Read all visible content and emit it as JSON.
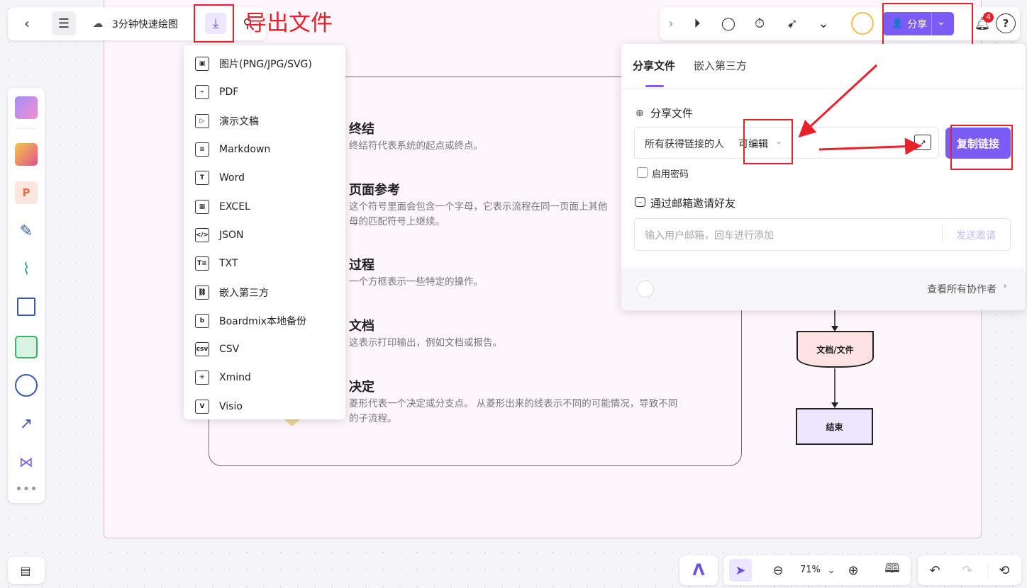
{
  "doc": {
    "title": "3分钟快速绘图"
  },
  "annotation": {
    "export_label": "导出文件"
  },
  "export_menu": {
    "items": [
      {
        "label": "图片(PNG/JPG/SVG)",
        "icon": "image-icon",
        "glyph": "▣"
      },
      {
        "label": "PDF",
        "icon": "pdf-icon",
        "glyph": "⌁"
      },
      {
        "label": "演示文稿",
        "icon": "presentation-icon",
        "glyph": "▷"
      },
      {
        "label": "Markdown",
        "icon": "markdown-icon",
        "glyph": "≡"
      },
      {
        "label": "Word",
        "icon": "word-icon",
        "glyph": "T"
      },
      {
        "label": "EXCEL",
        "icon": "excel-icon",
        "glyph": "▦"
      },
      {
        "label": "JSON",
        "icon": "json-icon",
        "glyph": "</>"
      },
      {
        "label": "TXT",
        "icon": "txt-icon",
        "glyph": "T≡"
      },
      {
        "label": "嵌入第三方",
        "icon": "embed-icon",
        "glyph": "⛓"
      },
      {
        "label": "Boardmix本地备份",
        "icon": "backup-icon",
        "glyph": "b"
      },
      {
        "label": "CSV",
        "icon": "csv-icon",
        "glyph": "csv"
      },
      {
        "label": "Xmind",
        "icon": "xmind-icon",
        "glyph": "✳"
      },
      {
        "label": "Visio",
        "icon": "visio-icon",
        "glyph": "V"
      }
    ]
  },
  "legend": {
    "items": [
      {
        "title": "终结",
        "desc": "终结符代表系统的起点或终点。"
      },
      {
        "title": "页面参考",
        "desc": "这个符号里面会包含一个字母，它表示流程在同一页面上其他\n母的匹配符号上继续。"
      },
      {
        "title": "过程",
        "desc": "一个方框表示一些特定的操作。"
      },
      {
        "title": "文档",
        "desc": "这表示打印输出，例如文档或报告。"
      },
      {
        "title": "决定",
        "desc": "菱形代表一个决定或分支点。 从菱形出来的线表示不同的可能情况，导致不同\n的子流程。"
      }
    ]
  },
  "flowchart": {
    "doc_label": "文档/文件",
    "end_label": "结束"
  },
  "top_right": {
    "share_button": "分享",
    "notification_count": "4"
  },
  "share_panel": {
    "tabs": [
      "分享文件",
      "嵌入第三方"
    ],
    "section_title": "分享文件",
    "link_scope": "所有获得链接的人",
    "permission": "可编辑",
    "copy_button": "复制链接",
    "password_label": "启用密码",
    "invite_title": "通过邮箱邀请好友",
    "email_placeholder": "输入用户邮箱，回车进行添加",
    "send_invite": "发送邀请",
    "view_collaborators": "查看所有协作者"
  },
  "bottom": {
    "zoom": "71%"
  },
  "colors": {
    "accent": "#7b5cf5",
    "annotation_red": "#e8212a",
    "frame_pink": "#f3b6dc"
  }
}
